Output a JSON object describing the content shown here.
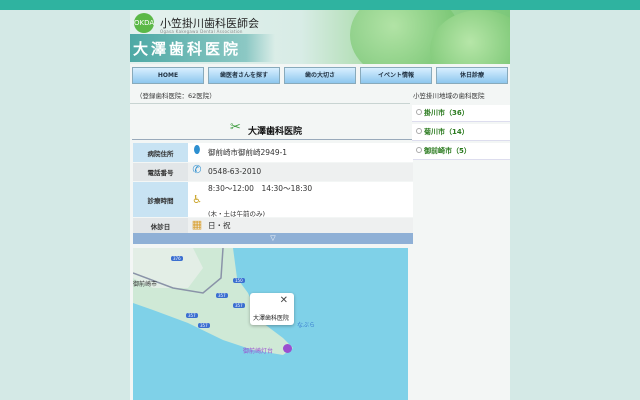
{
  "header": {
    "org_name": "小笠掛川歯科医師会",
    "org_sub": "Ogasa Kakegawa Dental Association",
    "logo_text": "OKDA",
    "page_title": "大澤歯科医院"
  },
  "nav": [
    "HOME",
    "歯医者さんを探す",
    "歯の大切さ",
    "イベント情報",
    "休日診療"
  ],
  "registered_count": "（登録歯科医院：62医院）",
  "sidebar": {
    "title": "小笠掛川地域の歯科医院",
    "items": [
      "掛川市（36）",
      "菊川市（14）",
      "御前崎市（5）"
    ]
  },
  "clinic": {
    "name": "大澤歯科医院",
    "rows": [
      {
        "label": "病院住所",
        "value": "御前崎市御前崎2949-1"
      },
      {
        "label": "電話番号",
        "value": "0548-63-2010"
      },
      {
        "label": "診療時間",
        "value": "8:30〜12:00　14:30〜18:30",
        "note": "(木・土は午前のみ)"
      },
      {
        "label": "休診日",
        "value": "日・祝"
      }
    ],
    "expand": "▽"
  },
  "map": {
    "city_label": "御前崎市",
    "popup_name": "大澤歯科医院",
    "poi": "御前崎灯台",
    "poi2": "なぶら",
    "close": "✕",
    "routes": [
      "376",
      "150",
      "357",
      "357",
      "357",
      "357"
    ]
  }
}
